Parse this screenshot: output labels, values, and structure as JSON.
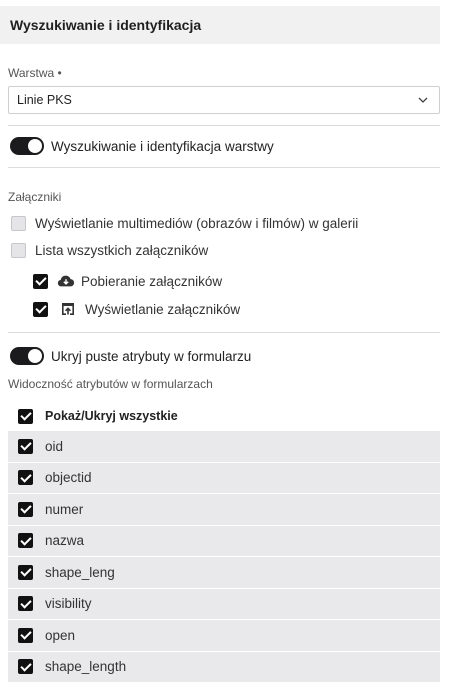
{
  "header": {
    "title": "Wyszukiwanie i identyfikacja"
  },
  "layer": {
    "label": "Warstwa •",
    "selected": "Linie PKS"
  },
  "search_toggle": {
    "label": "Wyszukiwanie i identyfikacja warstwy",
    "on": true
  },
  "attachments": {
    "label": "Załączniki",
    "options": [
      {
        "label": "Wyświetlanie multimediów (obrazów i filmów) w galerii",
        "checked": false
      },
      {
        "label": "Lista wszystkich załączników",
        "checked": false
      }
    ],
    "sub_options": [
      {
        "label": "Pobieranie załączników",
        "icon": "cloud-download-icon",
        "checked": true
      },
      {
        "label": "Wyświetlanie załączników",
        "icon": "open-external-icon",
        "checked": true
      }
    ]
  },
  "hide_empty_toggle": {
    "label": "Ukryj puste atrybuty w formularzu",
    "on": true
  },
  "attributes": {
    "label": "Widoczność atrybutów w formularzach",
    "header": "Pokaż/Ukryj wszystkie",
    "items": [
      {
        "name": "oid",
        "checked": true
      },
      {
        "name": "objectid",
        "checked": true
      },
      {
        "name": "numer",
        "checked": true
      },
      {
        "name": "nazwa",
        "checked": true
      },
      {
        "name": "shape_leng",
        "checked": true
      },
      {
        "name": "visibility",
        "checked": true
      },
      {
        "name": "open",
        "checked": true
      },
      {
        "name": "shape_length",
        "checked": true
      }
    ]
  }
}
